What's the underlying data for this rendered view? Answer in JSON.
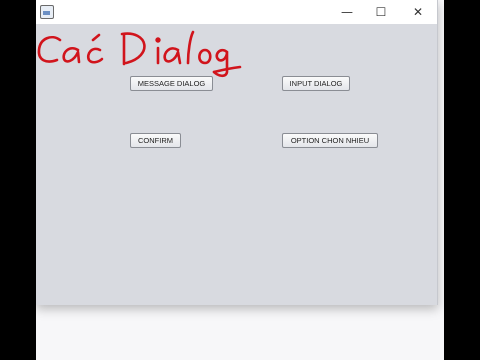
{
  "window": {
    "controls": {
      "minimize": "—",
      "maximize": "☐",
      "close": "✕"
    },
    "buttons": {
      "message_dialog": "MESSAGE DIALOG",
      "input_dialog": "INPUT DIALOG",
      "confirm": "CONFIRM",
      "option_chon_nhieu": "OPTION CHON NHIEU"
    }
  },
  "annotation": {
    "handwritten_title": "Các Dialog",
    "ink_color": "#d1141c"
  },
  "icons": {
    "app": "java-app-icon"
  }
}
